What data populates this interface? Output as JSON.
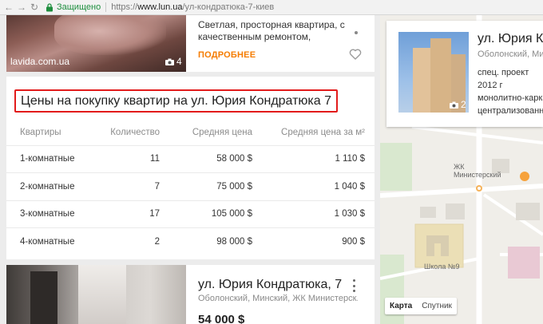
{
  "browser": {
    "secure_label": "Защищено",
    "url_scheme": "https://",
    "url_host": "www.lun.ua",
    "url_path": "/ул-кондратюка-7-киев"
  },
  "listing_top": {
    "source": "lavida.com.ua",
    "photo_count": "4",
    "description": "Светлая, просторная квартира, с качественным ремонтом,",
    "more_label": "ПОДРОБНЕЕ"
  },
  "prices": {
    "title": "Цены на покупку квартир на ул. Юрия Кондратюка 7",
    "headers": [
      "Квартиры",
      "Количество",
      "Средняя цена",
      "Средняя цена за м²"
    ],
    "rows": [
      [
        "1-комнатные",
        "11",
        "58 000 $",
        "1 110 $"
      ],
      [
        "2-комнатные",
        "7",
        "75 000 $",
        "1 040 $"
      ],
      [
        "3-комнатные",
        "17",
        "105 000 $",
        "1 030 $"
      ],
      [
        "4-комнатные",
        "2",
        "98 000 $",
        "900 $"
      ]
    ]
  },
  "listing_bottom": {
    "title": "ул. Юрия Кондратюка, 7",
    "subtitle": "Оболонский, Минский, ЖК Министерск...",
    "price": "54 000 $"
  },
  "building": {
    "title": "ул. Юрия Ког",
    "subtitle": "Оболонский, Ми",
    "photo_count": "2",
    "lines": [
      "спец. проект",
      "2012 г",
      "монолитно-каркас",
      "централизованно"
    ]
  },
  "map": {
    "labels": [
      "ЖК",
      "Министерский",
      "Школа №9"
    ],
    "toggle": [
      "Карта",
      "Спутник"
    ]
  },
  "colors": {
    "accent": "#f57c00",
    "highlight_border": "#e21b1b",
    "secure_green": "#1e8e3e"
  }
}
